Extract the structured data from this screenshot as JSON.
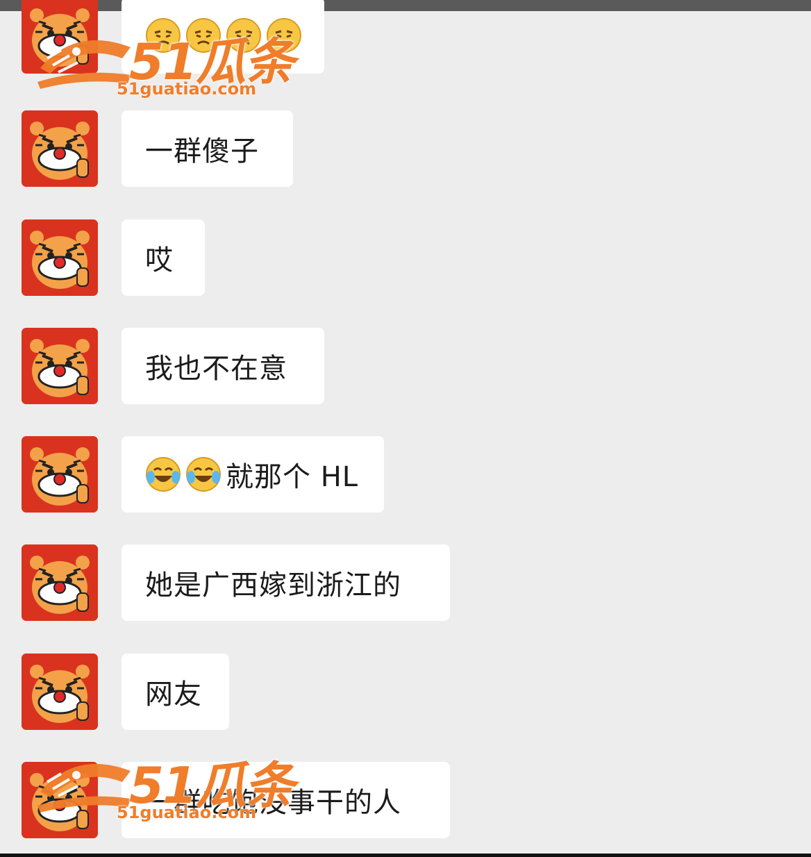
{
  "messages": [
    {
      "emoji": [
        "persevere-face",
        "persevere-face",
        "persevere-face",
        "persevere-face"
      ],
      "text": ""
    },
    {
      "emoji": [],
      "text": "一群傻子"
    },
    {
      "emoji": [],
      "text": "哎"
    },
    {
      "emoji": [],
      "text": "我也不在意"
    },
    {
      "emoji": [
        "tears-of-joy-face",
        "tears-of-joy-face"
      ],
      "text": "就那个 HL"
    },
    {
      "emoji": [],
      "text": "她是广西嫁到浙江的"
    },
    {
      "emoji": [],
      "text": "网友"
    },
    {
      "emoji": [],
      "text": "一群吃饱没事干的人"
    }
  ],
  "watermark": {
    "brand": "51瓜条",
    "url": "51guatiao.com"
  },
  "colors": {
    "background": "#ededed",
    "bubble": "#ffffff",
    "watermark": "#f07d2a",
    "avatar": "#d9331f"
  }
}
